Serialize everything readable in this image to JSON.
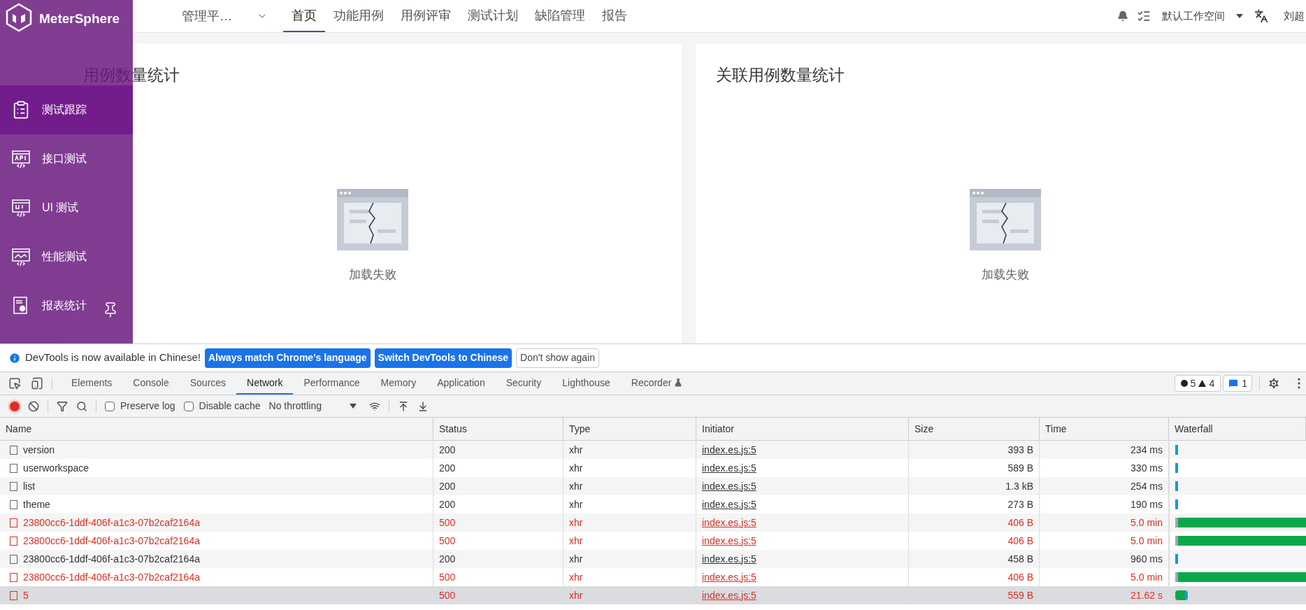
{
  "app": {
    "logo": "MeterSphere",
    "project": "管理平…",
    "nav": [
      {
        "label": "首页",
        "selected": true
      },
      {
        "label": "功能用例",
        "selected": false
      },
      {
        "label": "用例评审",
        "selected": false
      },
      {
        "label": "测试计划",
        "selected": false
      },
      {
        "label": "缺陷管理",
        "selected": false
      },
      {
        "label": "报告",
        "selected": false
      }
    ],
    "workspace": "默认工作空间",
    "user": "刘超",
    "sidebar": [
      {
        "kind": "clipboard",
        "label": "测试跟踪",
        "selected": true
      },
      {
        "kind": "api",
        "label": "接口测试",
        "selected": false
      },
      {
        "kind": "ui",
        "label": "UI 测试",
        "selected": false
      },
      {
        "kind": "perf",
        "label": "性能测试",
        "selected": false
      },
      {
        "kind": "report",
        "label": "报表统计",
        "selected": false
      }
    ],
    "cards": [
      {
        "title": "用例数量统计",
        "message": "加载失败"
      },
      {
        "title": "关联用例数量统计",
        "message": "加载失败"
      }
    ]
  },
  "devtools": {
    "infobar": {
      "message": "DevTools is now available in Chinese!",
      "buttons": [
        {
          "label": "Always match Chrome's language",
          "primary": true
        },
        {
          "label": "Switch DevTools to Chinese",
          "primary": true
        },
        {
          "label": "Don't show again",
          "primary": false
        }
      ]
    },
    "tabs": [
      {
        "label": "Elements",
        "selected": false
      },
      {
        "label": "Console",
        "selected": false
      },
      {
        "label": "Sources",
        "selected": false
      },
      {
        "label": "Network",
        "selected": true
      },
      {
        "label": "Performance",
        "selected": false
      },
      {
        "label": "Memory",
        "selected": false
      },
      {
        "label": "Application",
        "selected": false
      },
      {
        "label": "Security",
        "selected": false
      },
      {
        "label": "Lighthouse",
        "selected": false
      },
      {
        "label": "Recorder",
        "selected": false
      }
    ],
    "errors": "5",
    "warnings": "4",
    "messages": "1",
    "toolbar": {
      "preserve_log": {
        "label": "Preserve log",
        "checked": false
      },
      "disable_cache": {
        "label": "Disable cache",
        "checked": false
      },
      "throttling": "No throttling"
    },
    "columns": [
      "Name",
      "Status",
      "Type",
      "Initiator",
      "Size",
      "Time",
      "Waterfall"
    ],
    "rows": [
      {
        "name": "version",
        "status": "200",
        "type": "xhr",
        "initiator": "index.es.js:5",
        "size": "393 B",
        "time": "234 ms",
        "error": false,
        "selected": false,
        "kind": "tick"
      },
      {
        "name": "userworkspace",
        "status": "200",
        "type": "xhr",
        "initiator": "index.es.js:5",
        "size": "589 B",
        "time": "330 ms",
        "error": false,
        "selected": false,
        "kind": "tick"
      },
      {
        "name": "list",
        "status": "200",
        "type": "xhr",
        "initiator": "index.es.js:5",
        "size": "1.3 kB",
        "time": "254 ms",
        "error": false,
        "selected": false,
        "kind": "tick"
      },
      {
        "name": "theme",
        "status": "200",
        "type": "xhr",
        "initiator": "index.es.js:5",
        "size": "273 B",
        "time": "190 ms",
        "error": false,
        "selected": false,
        "kind": "tick"
      },
      {
        "name": "23800cc6-1ddf-406f-a1c3-07b2caf2164a",
        "status": "500",
        "type": "xhr",
        "initiator": "index.es.js:5",
        "size": "406 B",
        "time": "5.0 min",
        "error": true,
        "selected": false,
        "kind": "long"
      },
      {
        "name": "23800cc6-1ddf-406f-a1c3-07b2caf2164a",
        "status": "500",
        "type": "xhr",
        "initiator": "index.es.js:5",
        "size": "406 B",
        "time": "5.0 min",
        "error": true,
        "selected": false,
        "kind": "long"
      },
      {
        "name": "23800cc6-1ddf-406f-a1c3-07b2caf2164a",
        "status": "200",
        "type": "xhr",
        "initiator": "index.es.js:5",
        "size": "458 B",
        "time": "960 ms",
        "error": false,
        "selected": false,
        "kind": "tick"
      },
      {
        "name": "23800cc6-1ddf-406f-a1c3-07b2caf2164a",
        "status": "500",
        "type": "xhr",
        "initiator": "index.es.js:5",
        "size": "406 B",
        "time": "5.0 min",
        "error": true,
        "selected": false,
        "kind": "long"
      },
      {
        "name": "5",
        "status": "500",
        "type": "xhr",
        "initiator": "index.es.js:5",
        "size": "559 B",
        "time": "21.62 s",
        "error": true,
        "selected": true,
        "kind": "short"
      }
    ]
  }
}
